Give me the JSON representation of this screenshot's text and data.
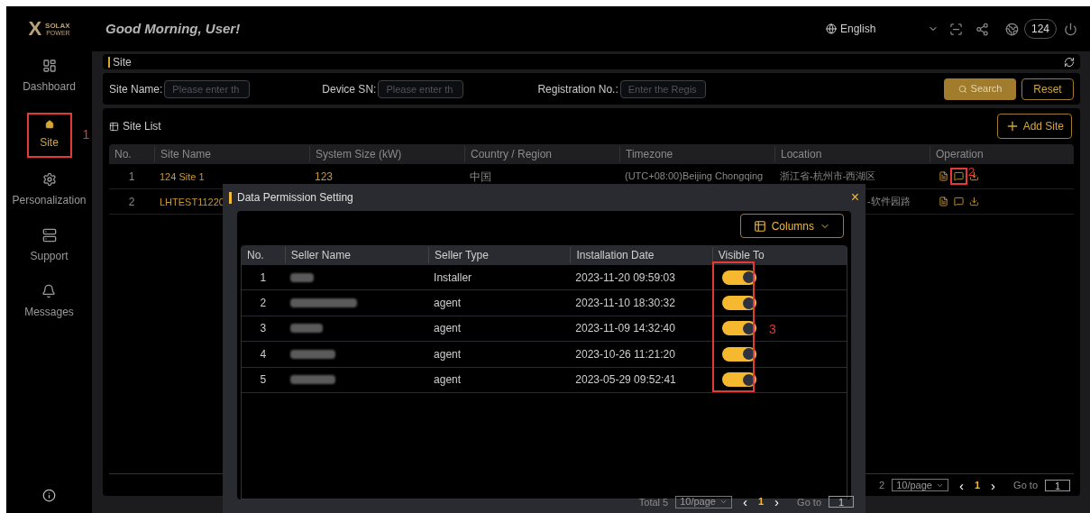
{
  "logo": {
    "mark": "X",
    "name": "SOLAX",
    "sub": "POWER"
  },
  "header": {
    "greeting": "Good Morning, User!",
    "language": "English",
    "badge": "124"
  },
  "sidebar": {
    "items": [
      {
        "label": "Dashboard",
        "selected": false
      },
      {
        "label": "Site",
        "selected": true
      },
      {
        "label": "Personalization",
        "selected": false
      },
      {
        "label": "Support",
        "selected": false
      },
      {
        "label": "Messages",
        "selected": false
      }
    ]
  },
  "breadcrumb": "Site",
  "filters": [
    {
      "label": "Site Name:",
      "placeholder": "Please enter th"
    },
    {
      "label": "Device SN:",
      "placeholder": "Please enter th"
    },
    {
      "label": "Registration No.:",
      "placeholder": "Enter the Regis"
    }
  ],
  "search_button": "Search",
  "reset_button": "Reset",
  "site_list": {
    "title": "Site List",
    "add_button": "Add Site",
    "columns": [
      "No.",
      "Site Name",
      "System Size (kW)",
      "Country / Region",
      "Timezone",
      "Location",
      "Operation"
    ],
    "rows": [
      {
        "no": "1",
        "name": "124 Site 1",
        "size": "123",
        "country": "中国",
        "timezone": "(UTC+08:00)Beijing Chongqing",
        "location": "浙江省-杭州市-西湖区"
      },
      {
        "no": "2",
        "name": "LHTEST11220",
        "location": "-软件园路"
      }
    ],
    "pagination": {
      "total": "2",
      "page_size": "10/page",
      "prev": "‹",
      "page": "1",
      "next": "›",
      "goto": "Go to",
      "goto_value": "1"
    }
  },
  "modal": {
    "title": "Data Permission Setting",
    "close": "×",
    "columns_button": "Columns",
    "columns": [
      "No.",
      "Seller Name",
      "Seller Type",
      "Installation Date",
      "Visible To"
    ],
    "rows": [
      {
        "no": "1",
        "type": "Installer",
        "date": "2023-11-20 09:59:03",
        "visible": true
      },
      {
        "no": "2",
        "type": "agent",
        "date": "2023-11-10 18:30:32",
        "visible": true
      },
      {
        "no": "3",
        "type": "agent",
        "date": "2023-11-09 14:32:40",
        "visible": true
      },
      {
        "no": "4",
        "type": "agent",
        "date": "2023-10-26 11:21:20",
        "visible": true
      },
      {
        "no": "5",
        "type": "agent",
        "date": "2023-05-29 09:52:41",
        "visible": true
      }
    ],
    "pagination": {
      "total": "Total 5",
      "page_size": "10/page",
      "prev": "‹",
      "page": "1",
      "next": "›",
      "goto": "Go to",
      "goto_value": "1"
    }
  },
  "annotations": [
    "1",
    "2",
    "3"
  ]
}
